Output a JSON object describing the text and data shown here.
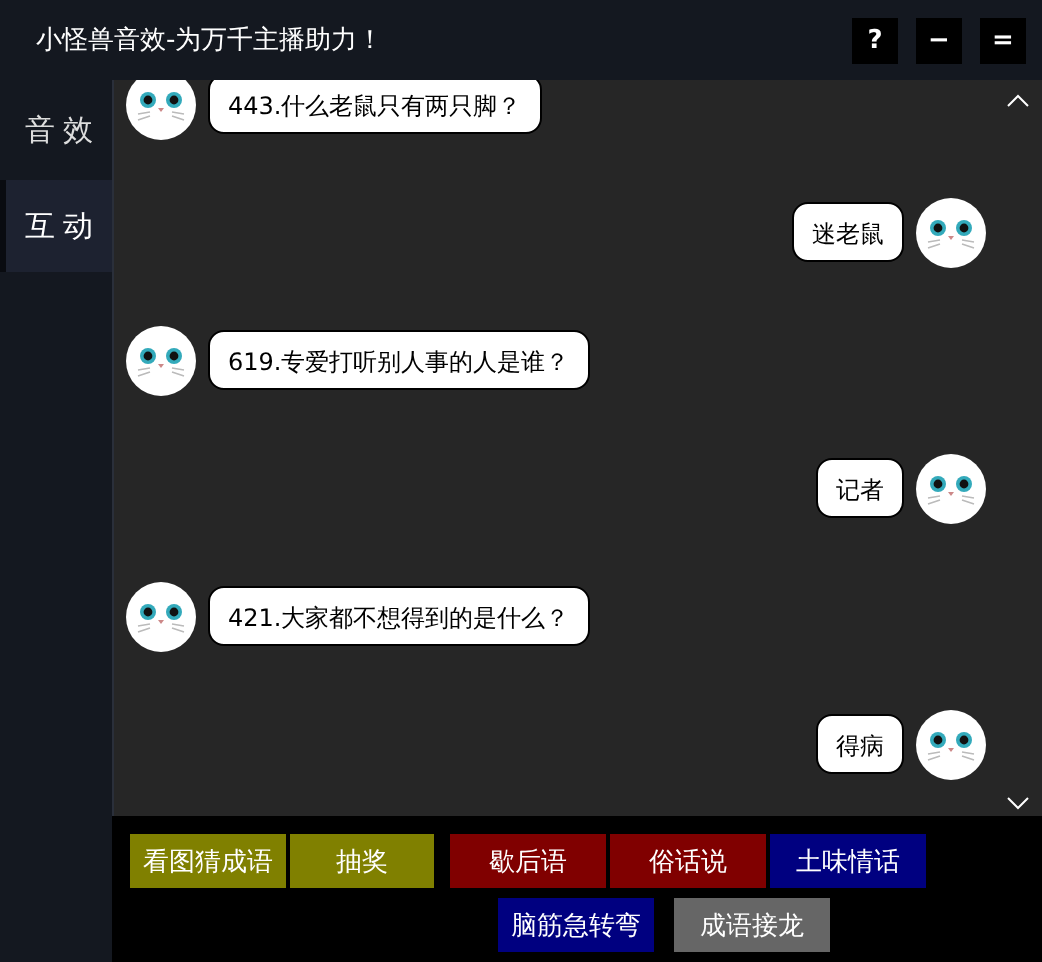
{
  "window": {
    "title": "小怪兽音效-为万千主播助力！",
    "controls": [
      "?",
      "−",
      "="
    ]
  },
  "sidebar": {
    "items": [
      {
        "label": "音效",
        "selected": false
      },
      {
        "label": "互动",
        "selected": true
      }
    ]
  },
  "messages": [
    {
      "kind": "incoming",
      "text": "443.什么老鼠只有两只脚？"
    },
    {
      "kind": "outgoing",
      "text": "迷老鼠"
    },
    {
      "kind": "incoming",
      "text": "619.专爱打听别人事的人是谁？"
    },
    {
      "kind": "outgoing",
      "text": "记者"
    },
    {
      "kind": "incoming",
      "text": "421.大家都不想得到的是什么？"
    },
    {
      "kind": "outgoing",
      "text": "得病"
    }
  ],
  "buttons": [
    [
      {
        "label": "看图猜成语",
        "color": "#808000"
      },
      {
        "label": "抽奖",
        "color": "#808000"
      },
      {
        "label": "歇后语",
        "color": "#800000"
      },
      {
        "label": "俗话说",
        "color": "#800000"
      },
      {
        "label": "土味情话",
        "color": "#000080"
      }
    ],
    [
      {
        "label": "脑筋急转弯",
        "color": "#000080"
      },
      {
        "label": "成语接龙",
        "color": "#666666"
      }
    ]
  ]
}
